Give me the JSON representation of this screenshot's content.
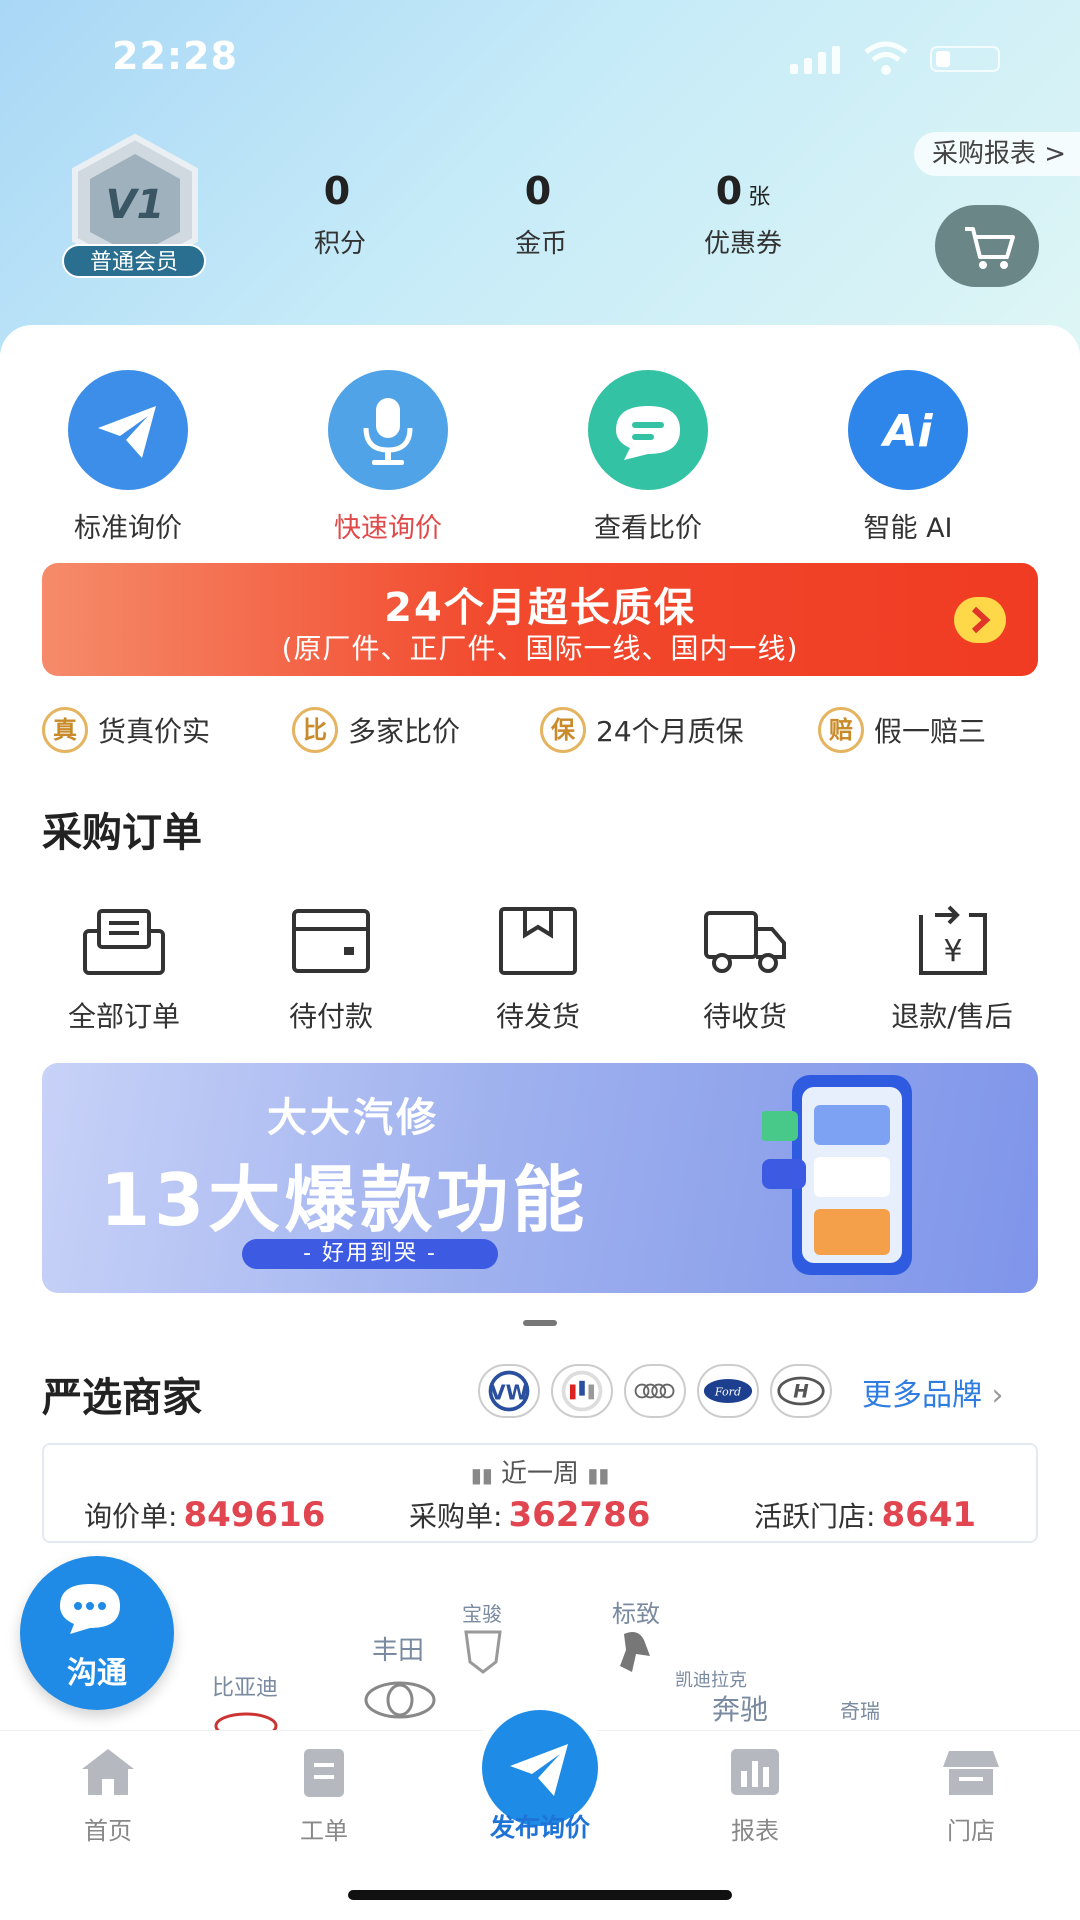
{
  "status_bar": {
    "time": "22:28"
  },
  "header": {
    "report_link": "采购报表 >",
    "member": {
      "level": "V1",
      "label": "普通会员"
    },
    "stats": [
      {
        "value": "0",
        "unit": "",
        "label": "积分"
      },
      {
        "value": "0",
        "unit": "",
        "label": "金币"
      },
      {
        "value": "0",
        "unit": "张",
        "label": "优惠券"
      }
    ]
  },
  "quick_actions": [
    {
      "label": "标准询价",
      "icon": "paper-plane-icon",
      "color": "#3d8ee8"
    },
    {
      "label": "快速询价",
      "icon": "microphone-icon",
      "color": "#4fa3e6",
      "label_color": "#e04a4a"
    },
    {
      "label": "查看比价",
      "icon": "chat-bubble-icon",
      "color": "#34c2a5"
    },
    {
      "label": "智能 AI",
      "icon": "ai-icon",
      "color": "#2f86ea"
    }
  ],
  "promo_banner": {
    "title": "24个月超长质保",
    "subtitle": "(原厂件、正厂件、国际一线、国内一线)"
  },
  "guarantees": [
    {
      "badge": "真",
      "label": "货真价实"
    },
    {
      "badge": "比",
      "label": "多家比价"
    },
    {
      "badge": "保",
      "label": "24个月质保"
    },
    {
      "badge": "赔",
      "label": "假一赔三"
    }
  ],
  "orders": {
    "title": "采购订单",
    "items": [
      {
        "label": "全部订单",
        "icon": "inbox-icon"
      },
      {
        "label": "待付款",
        "icon": "wallet-icon"
      },
      {
        "label": "待发货",
        "icon": "box-icon"
      },
      {
        "label": "待收货",
        "icon": "truck-icon"
      },
      {
        "label": "退款/售后",
        "icon": "refund-icon"
      }
    ]
  },
  "feature_banner": {
    "brand": "大大汽修",
    "headline": "13大爆款功能",
    "tagline": "- 好用到哭 -"
  },
  "merchants": {
    "title": "严选商家",
    "more_brands": "更多品牌",
    "period": "近一周",
    "stats": [
      {
        "label": "询价单:",
        "value": "849616"
      },
      {
        "label": "采购单:",
        "value": "362786"
      },
      {
        "label": "活跃门店:",
        "value": "8641"
      }
    ],
    "brand_icons": [
      "volkswagen-logo-icon",
      "buick-logo-icon",
      "audi-logo-icon",
      "ford-logo-icon",
      "hyundai-logo-icon"
    ]
  },
  "chat_button": {
    "label": "沟通"
  },
  "brand_cloud": [
    {
      "label": "比亚迪"
    },
    {
      "label": "丰田"
    },
    {
      "label": "宝骏"
    },
    {
      "label": "标致"
    },
    {
      "label": "凯迪拉克"
    },
    {
      "label": "奔驰"
    },
    {
      "label": "奇瑞"
    }
  ],
  "tabbar": [
    {
      "label": "首页",
      "icon": "home-icon"
    },
    {
      "label": "工单",
      "icon": "clipboard-icon"
    },
    {
      "label": "发布询价",
      "icon": "paper-plane-icon",
      "active": true
    },
    {
      "label": "报表",
      "icon": "bar-chart-icon"
    },
    {
      "label": "门店",
      "icon": "store-icon"
    }
  ]
}
